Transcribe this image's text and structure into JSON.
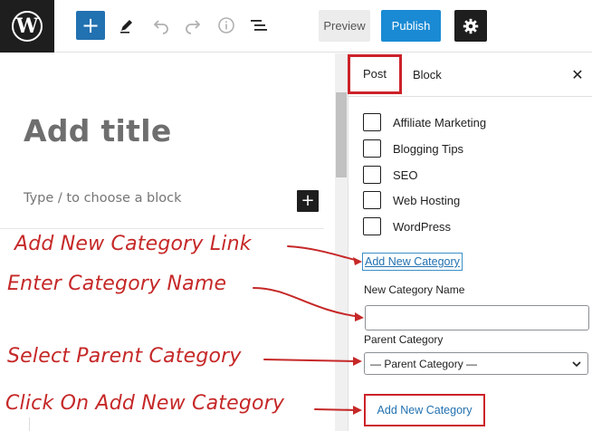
{
  "toolbar": {
    "logo_icon": "wordpress-logo-icon",
    "logo_glyph": "W",
    "add_block_glyph": "+",
    "preview_label": "Preview",
    "publish_label": "Publish",
    "tools": [
      "pencil-icon",
      "undo-icon",
      "redo-icon",
      "info-icon",
      "list-view-icon",
      "gear-icon"
    ]
  },
  "editor": {
    "title_placeholder": "Add title",
    "block_placeholder": "Type / to choose a block",
    "inline_add_glyph": "+"
  },
  "sidebar": {
    "tabs": [
      {
        "label": "Post"
      },
      {
        "label": "Block"
      }
    ],
    "close_glyph": "✕",
    "categories": [
      {
        "label": "Affiliate Marketing",
        "checked": false
      },
      {
        "label": "Blogging Tips",
        "checked": false
      },
      {
        "label": "SEO",
        "checked": false
      },
      {
        "label": "Web Hosting",
        "checked": false
      },
      {
        "label": "WordPress",
        "checked": false
      }
    ],
    "add_new_category_link": "Add New Category",
    "new_category_name_label": "New Category Name",
    "new_category_name_value": "",
    "parent_category_label": "Parent Category",
    "parent_category_selected": "— Parent Category —",
    "add_new_category_button": "Add New Category"
  },
  "annotations": [
    {
      "text": "Add New Category Link"
    },
    {
      "text": "Enter Category Name"
    },
    {
      "text": "Select Parent Category"
    },
    {
      "text": "Click On Add New Category"
    }
  ],
  "colors": {
    "annotation_red": "#c62828",
    "highlight_red": "#cc2229",
    "primary_blue": "#2271b1",
    "publish_blue": "#1a8ad4",
    "dark": "#1e1e1e"
  }
}
